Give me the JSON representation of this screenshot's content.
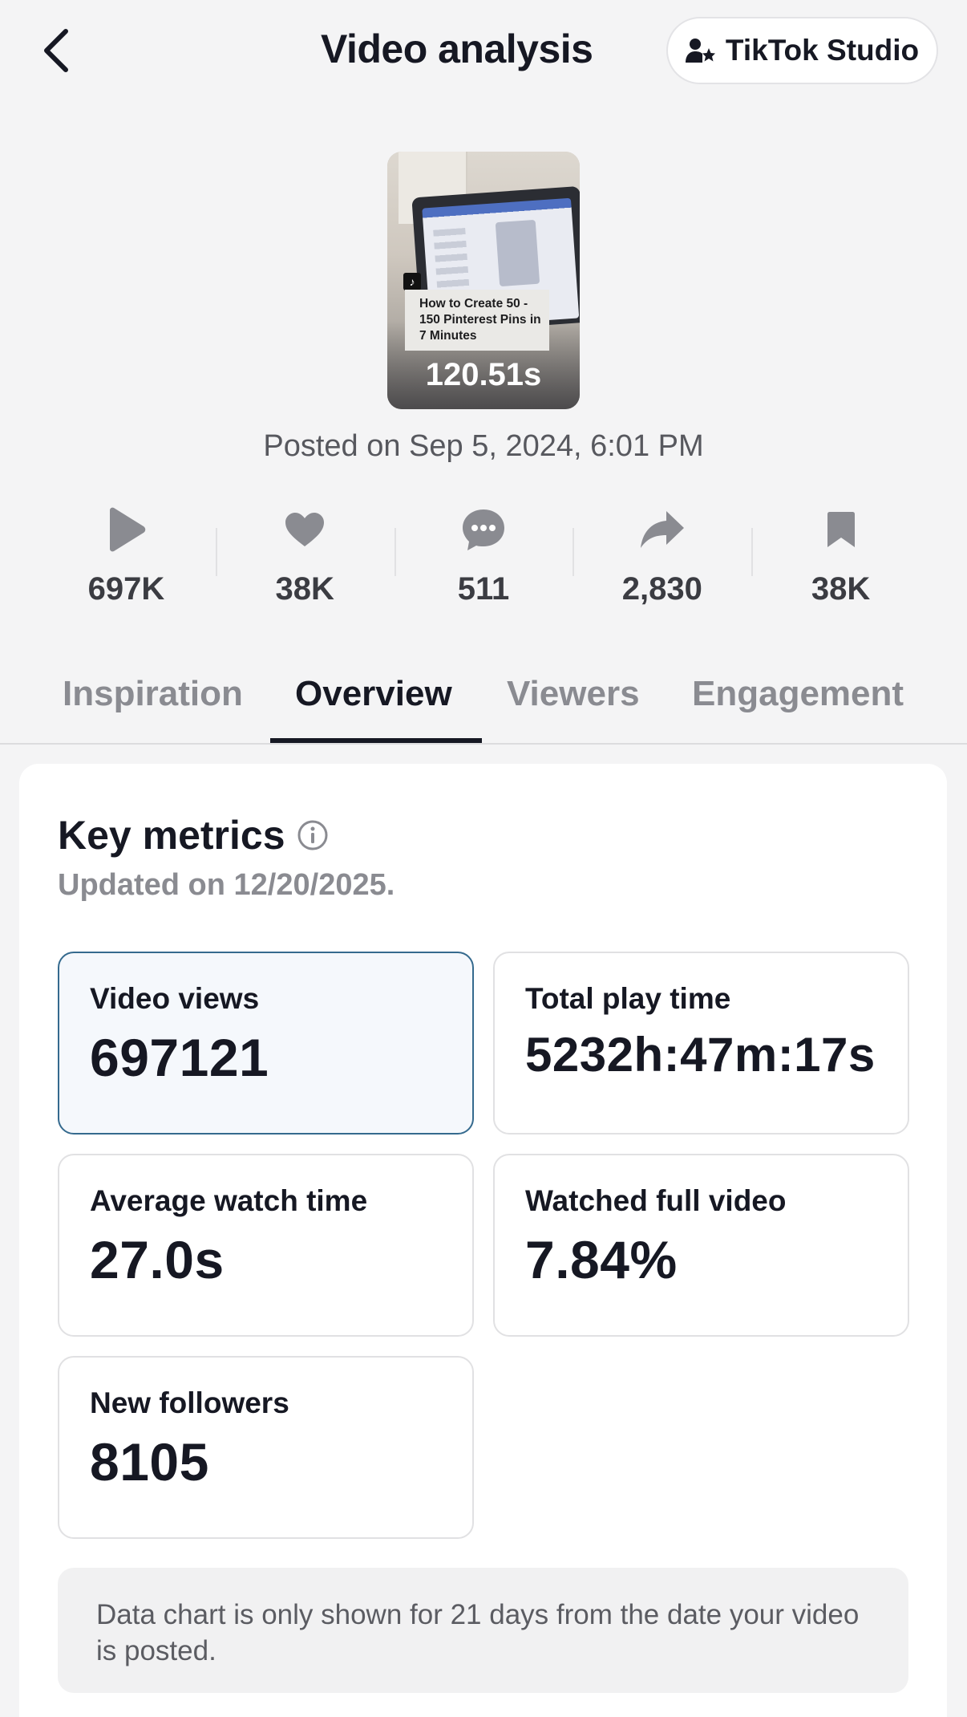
{
  "header": {
    "title": "Video analysis",
    "studio_button": "TikTok Studio"
  },
  "video": {
    "thumbnail_caption": "How to Create 50 - 150 Pinterest Pins in 7 Minutes",
    "duration": "120.51s",
    "posted": "Posted on Sep 5, 2024, 6:01 PM"
  },
  "stats": [
    {
      "icon": "play-icon",
      "value": "697K"
    },
    {
      "icon": "heart-icon",
      "value": "38K"
    },
    {
      "icon": "comment-icon",
      "value": "511"
    },
    {
      "icon": "share-icon",
      "value": "2,830"
    },
    {
      "icon": "bookmark-icon",
      "value": "38K"
    }
  ],
  "tabs": [
    {
      "label": "Inspiration",
      "active": false
    },
    {
      "label": "Overview",
      "active": true
    },
    {
      "label": "Viewers",
      "active": false
    },
    {
      "label": "Engagement",
      "active": false
    }
  ],
  "key_metrics": {
    "title": "Key metrics",
    "updated": "Updated on 12/20/2025.",
    "cards": [
      {
        "label": "Video views",
        "value": "697121",
        "selected": true
      },
      {
        "label": "Total play time",
        "value": "5232h:47m:17s",
        "selected": false
      },
      {
        "label": "Average watch time",
        "value": "27.0s",
        "selected": false
      },
      {
        "label": "Watched full video",
        "value": "7.84%",
        "selected": false
      },
      {
        "label": "New followers",
        "value": "8105",
        "selected": false
      }
    ],
    "notice": "Data chart is only shown for 21 days from the date your video is posted."
  },
  "colors": {
    "background": "#f4f4f5",
    "selected_border": "#356a8e",
    "selected_fill": "#f5f8fc",
    "text_primary": "#161823",
    "text_muted": "#8a8b91"
  }
}
